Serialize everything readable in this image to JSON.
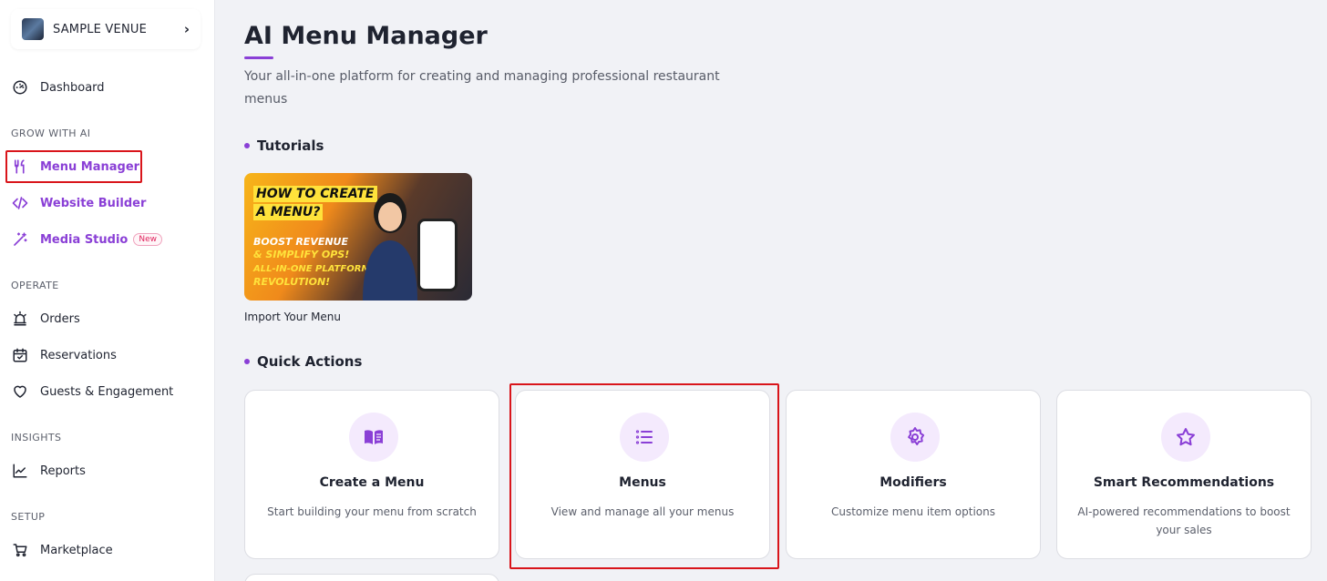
{
  "sidebar": {
    "venue_name": "SAMPLE VENUE",
    "dashboard": "Dashboard",
    "sections": {
      "grow": "GROW WITH AI",
      "operate": "OPERATE",
      "insights": "INSIGHTS",
      "setup": "SETUP"
    },
    "items": {
      "menu_manager": "Menu Manager",
      "website_builder": "Website Builder",
      "media_studio": "Media Studio",
      "media_studio_badge": "New",
      "orders": "Orders",
      "reservations": "Reservations",
      "guests": "Guests & Engagement",
      "reports": "Reports",
      "marketplace": "Marketplace"
    },
    "active_item": "Menu Manager"
  },
  "main": {
    "title": "AI Menu Manager",
    "subtitle": "Your all-in-one platform for creating and managing professional restaurant menus",
    "tutorials_heading": "Tutorials",
    "tutorial": {
      "caption": "Import Your Menu",
      "thumb_lines": [
        "HOW TO CREATE",
        "A MENU?",
        "BOOST REVENUE",
        "& SIMPLIFY OPS!",
        "ALL-IN-ONE PLATFORM",
        "REVOLUTION!"
      ]
    },
    "quick_actions_heading": "Quick Actions",
    "quick_actions": [
      {
        "title": "Create a Menu",
        "desc": "Start building your menu from scratch",
        "icon": "book-open-icon"
      },
      {
        "title": "Menus",
        "desc": "View and manage all your menus",
        "icon": "list-icon"
      },
      {
        "title": "Modifiers",
        "desc": "Customize menu item options",
        "icon": "gear-icon"
      },
      {
        "title": "Smart Recommendations",
        "desc": "AI-powered recommendations to boost your sales",
        "icon": "star-icon"
      }
    ]
  },
  "colors": {
    "accent": "#8a3fd6",
    "highlight": "#d9151b",
    "background": "#f1f2f6"
  }
}
